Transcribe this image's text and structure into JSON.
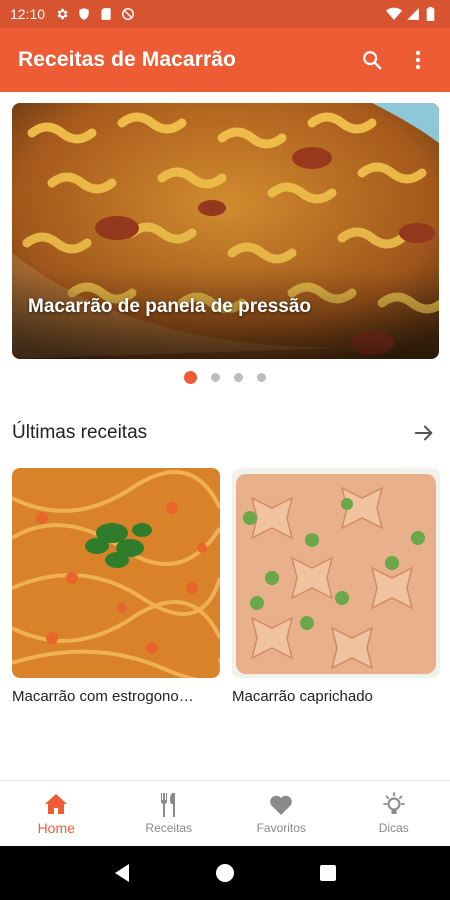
{
  "status_bar": {
    "time": "12:10",
    "left_icons": [
      "gear-icon",
      "shield-icon",
      "sd-card-icon",
      "do-not-disturb-icon"
    ],
    "right_icons": [
      "wifi-icon",
      "signal-icon",
      "battery-icon"
    ]
  },
  "app_bar": {
    "title": "Receitas de Macarrão",
    "actions": [
      "search-icon",
      "more-vert-icon"
    ]
  },
  "carousel": {
    "slide_title": "Macarrão de panela de pressão",
    "slide_count": 4,
    "active_index": 0
  },
  "latest": {
    "title": "Últimas receitas",
    "cards": [
      {
        "title": "Macarrão com estrogono…"
      },
      {
        "title": "Macarrão caprichado"
      }
    ]
  },
  "bottom_nav": {
    "items": [
      {
        "label": "Home",
        "icon": "home-icon",
        "active": true
      },
      {
        "label": "Receitas",
        "icon": "fork-knife-icon",
        "active": false
      },
      {
        "label": "Favoritos",
        "icon": "heart-icon",
        "active": false
      },
      {
        "label": "Dicas",
        "icon": "lightbulb-icon",
        "active": false
      }
    ]
  },
  "colors": {
    "status_bar": "#d8532f",
    "app_bar": "#ee5c36",
    "accent": "#ee5c36",
    "inactive": "#8a8a8a"
  }
}
